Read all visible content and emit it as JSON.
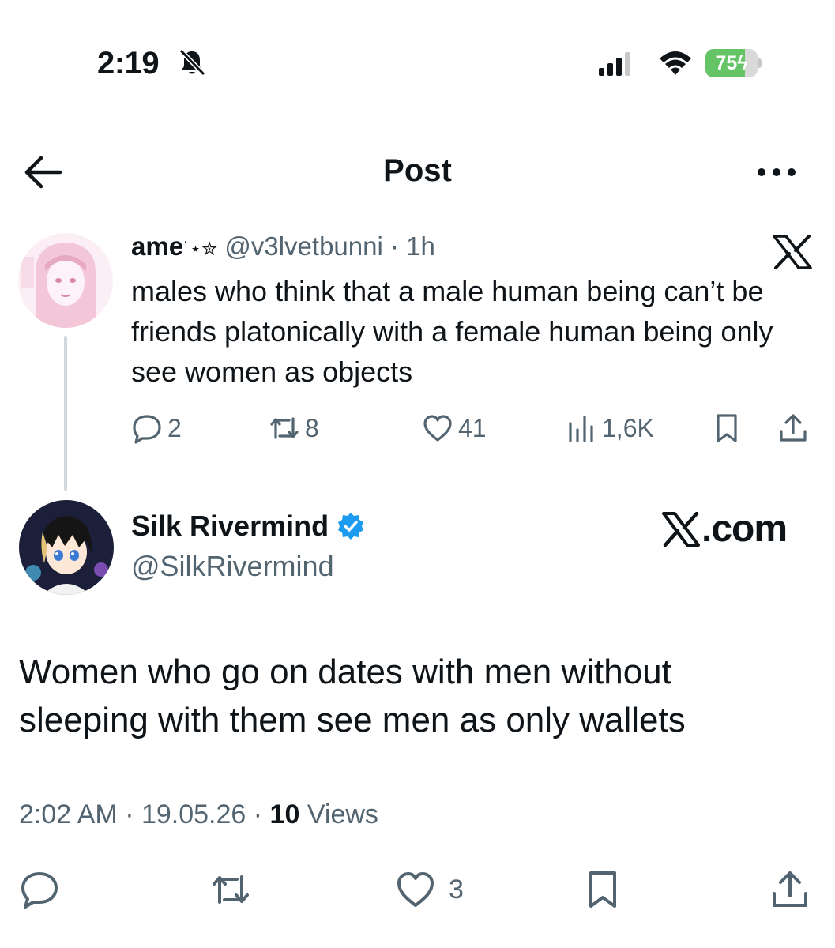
{
  "status_bar": {
    "time": "2:19",
    "battery": "75",
    "battery_level": 0.75,
    "colors": {
      "battery_fill": "#65c466"
    }
  },
  "header": {
    "title": "Post"
  },
  "quoted_post": {
    "name": "ame",
    "name_decoration": "˙⋆✮",
    "handle": "@v3lvetbunni",
    "separator": "·",
    "time_ago": "1h",
    "text": "males who think that a male human being can’t be friends platonically with a female human being only see women as objects",
    "replies": "2",
    "reposts": "8",
    "likes": "41",
    "views": "1,6K"
  },
  "main_post": {
    "name": "Silk Rivermind",
    "handle": "@SilkRivermind",
    "watermark": ".com",
    "text": "Women who go on dates with men without sleeping with them see men as only wallets",
    "time": "2:02 AM",
    "separator1": " · ",
    "date": "19.05.26",
    "separator2": " · ",
    "views_count": "10",
    "views_label": " Views",
    "likes": "3"
  },
  "colors": {
    "text_primary": "#0f1419",
    "text_secondary": "#536471",
    "verified_badge": "#1d9bf0",
    "divider": "#cfd9de"
  }
}
